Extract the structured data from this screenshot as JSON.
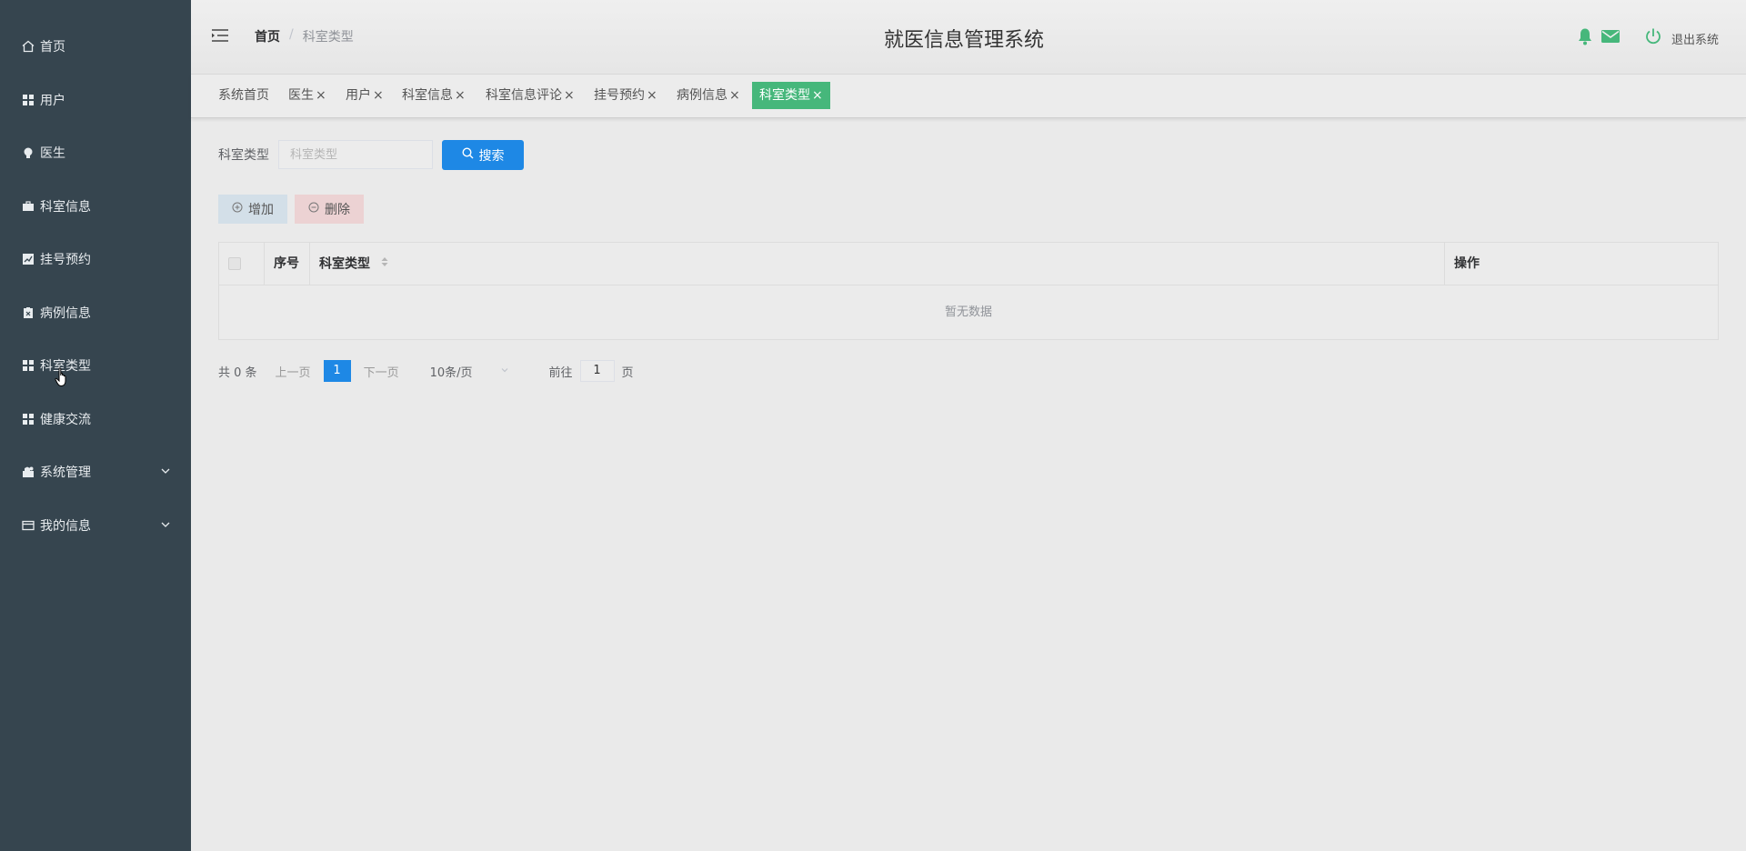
{
  "sidebar": {
    "items": [
      {
        "label": "首页",
        "icon": "home-icon"
      },
      {
        "label": "用户",
        "icon": "grid-icon"
      },
      {
        "label": "医生",
        "icon": "bulb-icon"
      },
      {
        "label": "科室信息",
        "icon": "briefcase-icon"
      },
      {
        "label": "挂号预约",
        "icon": "chart-icon"
      },
      {
        "label": "病例信息",
        "icon": "clipboard-icon"
      },
      {
        "label": "科室类型",
        "icon": "grid-icon"
      },
      {
        "label": "健康交流",
        "icon": "grid-icon"
      },
      {
        "label": "系统管理",
        "icon": "gear-icon"
      },
      {
        "label": "我的信息",
        "icon": "card-icon"
      }
    ]
  },
  "header": {
    "breadcrumb_home": "首页",
    "breadcrumb_sep": "/",
    "breadcrumb_current": "科室类型",
    "title": "就医信息管理系统",
    "logout": "退出系统"
  },
  "tags": [
    "系统首页",
    "医生",
    "用户",
    "科室信息",
    "科室信息评论",
    "挂号预约",
    "病例信息",
    "科室类型"
  ],
  "search": {
    "label": "科室类型",
    "placeholder": "科室类型",
    "button": "搜索"
  },
  "actions": {
    "add": "增加",
    "delete": "删除"
  },
  "table": {
    "columns": [
      "序号",
      "科室类型",
      "操作"
    ],
    "empty_text": "暂无数据"
  },
  "pagination": {
    "total": "共 0 条",
    "prev": "上一页",
    "current_page": "1",
    "next": "下一页",
    "page_size": "10条/页",
    "goto_label": "前往",
    "goto_value": "1",
    "page_suffix": "页"
  },
  "colors": {
    "sidebar_bg": "#36454f",
    "primary": "#1e88e5",
    "active_tag": "#46b77b"
  }
}
